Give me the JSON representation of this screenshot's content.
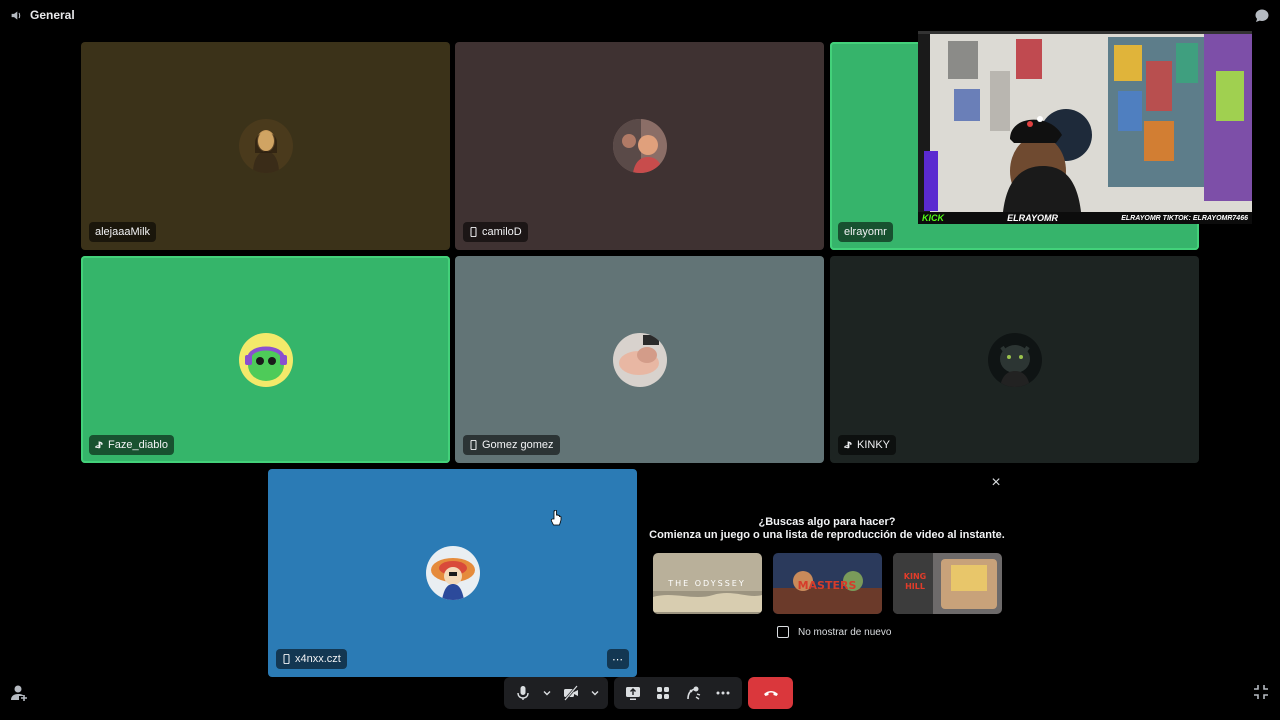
{
  "header": {
    "channel_name": "General",
    "channel_icon": "speaker-icon",
    "chat_icon": "chat-bubble-icon"
  },
  "participants": [
    {
      "name": "alejaaaMilk",
      "platform": "none",
      "bg": "#3b3219",
      "speaking": false
    },
    {
      "name": "camiloD",
      "platform": "mobile",
      "bg": "#3f3232",
      "speaking": false
    },
    {
      "name": "elrayomr",
      "platform": "none",
      "bg": "#36b46b",
      "speaking": true
    },
    {
      "name": "Faze_diablo",
      "platform": "playstation",
      "bg": "#35b56a",
      "speaking": true
    },
    {
      "name": "Gomez gomez",
      "platform": "mobile",
      "bg": "#627476",
      "speaking": false
    },
    {
      "name": "KINKY",
      "platform": "playstation",
      "bg": "#1d2422",
      "speaking": false
    },
    {
      "name": "x4nxx.czt",
      "platform": "mobile",
      "bg": "#2b7bb5",
      "speaking": false
    }
  ],
  "stream": {
    "kick_label": "KICK",
    "handle": "ELRAYOMR",
    "social": "ELRAYOMR  TIKTOK: ELRAYOMR7466"
  },
  "activity": {
    "title": "¿Buscas algo para hacer?",
    "subtitle": "Comienza un juego o una lista de reproducción de video al instante.",
    "cards": [
      {
        "name": "The Odyssey",
        "label": "THE ODYSSEY"
      },
      {
        "name": "Masters of the Universe",
        "label": "MASTERS"
      },
      {
        "name": "King of the Hill",
        "label": "KING HILL"
      }
    ],
    "checkbox_label": "No mostrar de nuevo",
    "checked": false
  },
  "controls": {
    "mic_icon": "microphone-icon",
    "camera_icon": "camera-off-icon",
    "screenshare_icon": "screen-share-icon",
    "activities_icon": "activities-icon",
    "soundboard_icon": "soundboard-icon",
    "more_icon": "more-icon",
    "leave_icon": "hang-up-icon"
  },
  "colors": {
    "speaking_ring": "#43d17a",
    "leave": "#da373c",
    "control_bg": "#1e1f22"
  }
}
